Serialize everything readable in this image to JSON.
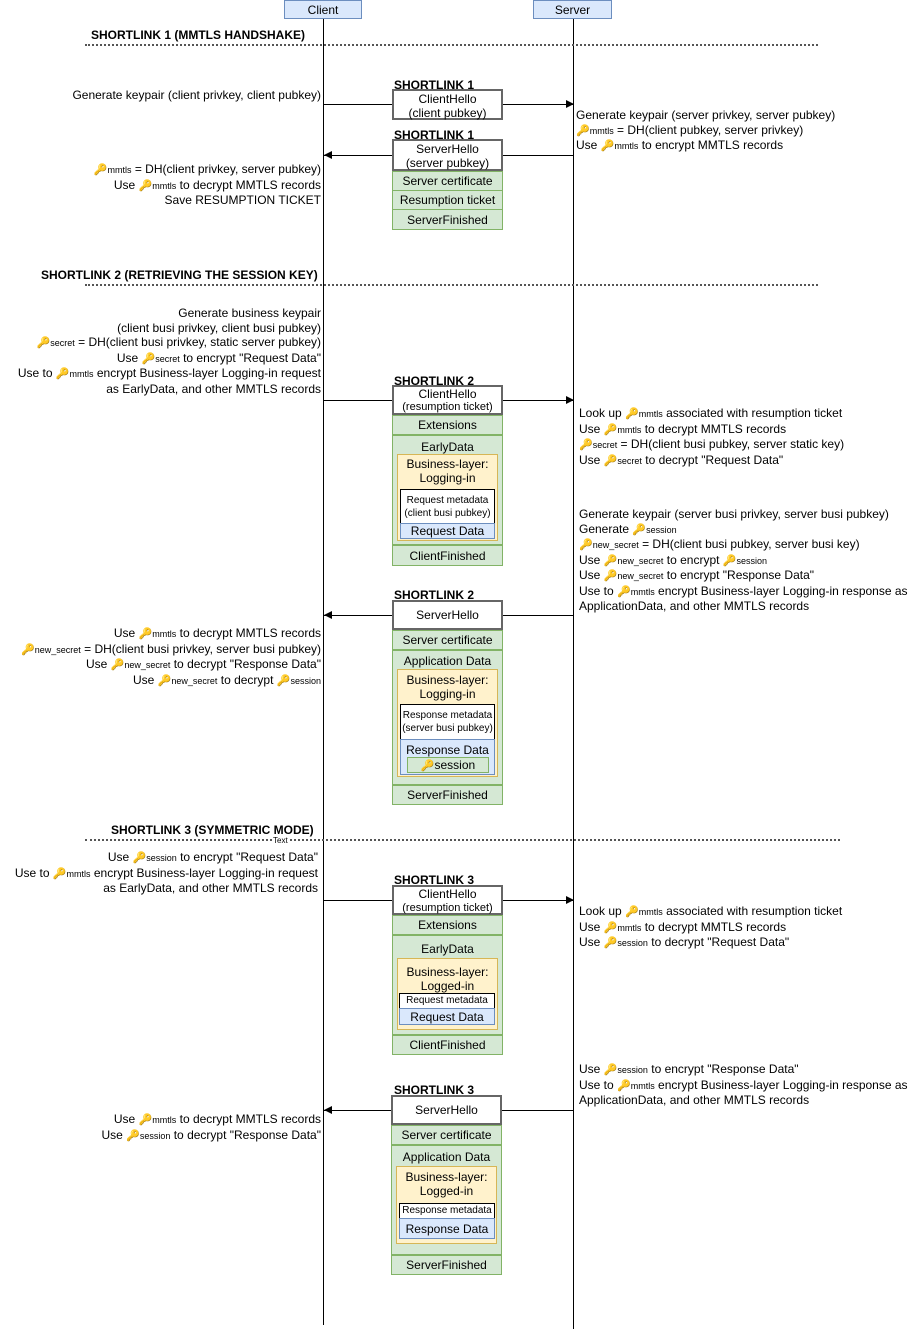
{
  "actors": {
    "client": "Client",
    "server": "Server"
  },
  "sections": [
    {
      "title": "SHORTLINK 1 (MMTLS HANDSHAKE)"
    },
    {
      "title": "SHORTLINK 2 (RETRIEVING THE SESSION KEY)"
    },
    {
      "title": "SHORTLINK 3 (SYMMETRIC MODE)",
      "annotation": "Text"
    }
  ],
  "key_glyph": "🔑",
  "keys": {
    "mmtls": "mmtls",
    "secret": "secret",
    "new_secret": "new_secret",
    "session": "session"
  },
  "sl1": {
    "label_a": "SHORTLINK 1",
    "label_b": "SHORTLINK 1",
    "client_hello": [
      "ClientHello",
      "(client pubkey)"
    ],
    "server_hello": [
      "ServerHello",
      "(server pubkey)"
    ],
    "records": [
      "Server certificate",
      "Resumption ticket",
      "ServerFinished"
    ],
    "client_note_1": "Generate keypair (client privkey, client pubkey)",
    "server_notes": {
      "l1": "Generate keypair (server privkey, server pubkey)",
      "l2_post": " = DH(client pubkey, server privkey)",
      "l3_pre": "Use ",
      "l3_post": " to encrypt MMTLS records"
    },
    "client_notes": {
      "l1_post": " = DH(client privkey, server pubkey)",
      "l2_pre": "Use ",
      "l2_post": " to decrypt MMTLS records",
      "l3": "Save RESUMPTION TICKET"
    }
  },
  "sl2": {
    "label_a": "SHORTLINK 2",
    "label_b": "SHORTLINK 2",
    "client_hello": [
      "ClientHello",
      "(resumption ticket)"
    ],
    "extensions": "Extensions",
    "early_data": "EarlyData",
    "business_layer": [
      "Business-layer:",
      "Logging-in"
    ],
    "request_metadata": [
      "Request metadata",
      "(client busi pubkey)"
    ],
    "request_data": "Request Data",
    "client_finished": "ClientFinished",
    "server_hello": "ServerHello",
    "server_certificate": "Server certificate",
    "application_data": "Application Data",
    "response_metadata": [
      "Response metadata",
      "(server busi pubkey)"
    ],
    "response_data": "Response Data",
    "session_key_label": "session",
    "server_finished": "ServerFinished",
    "client_pre": {
      "l1": "Generate business keypair",
      "l2": "(client busi privkey, client busi pubkey)",
      "l3_post": " = DH(client busi privkey, static server pubkey)",
      "l4_pre": "Use ",
      "l4_post": " to encrypt \"Request Data\"",
      "l5_pre": "Use to ",
      "l5_post": " encrypt Business-layer Logging-in request",
      "l6": "as EarlyData, and other MMTLS records"
    },
    "server_a": {
      "l1_pre": "Look up ",
      "l1_post": " associated with resumption ticket",
      "l2_pre": "Use ",
      "l2_post": " to decrypt MMTLS records",
      "l3_post": " = DH(client busi pubkey, server static key)",
      "l4_pre": "Use ",
      "l4_post": " to decrypt \"Request Data\""
    },
    "server_b": {
      "l1": "Generate keypair (server busi privkey, server busi pubkey)",
      "l2_pre": "Generate ",
      "l3_post": " = DH(client busi pubkey, server busi key)",
      "l4_pre": "Use ",
      "l4_mid": " to encrypt ",
      "l5_pre": "Use ",
      "l5_post": " to encrypt \"Response Data\"",
      "l6_pre": "Use to ",
      "l6_post": " encrypt Business-layer Logging-in response as",
      "l7": "ApplicationData, and other MMTLS records"
    },
    "client_post": {
      "l1_pre": "Use ",
      "l1_post": " to decrypt MMTLS records",
      "l2_post": " = DH(client busi privkey, server busi pubkey)",
      "l3_pre": "Use ",
      "l3_post": " to decrypt \"Response Data\"",
      "l4_pre": "Use ",
      "l4_mid": " to decrypt "
    }
  },
  "sl3": {
    "label_a": "SHORTLINK 3",
    "label_b": "SHORTLINK 3",
    "client_hello": [
      "ClientHello",
      "(resumption ticket)"
    ],
    "extensions": "Extensions",
    "early_data": "EarlyData",
    "business_layer": [
      "Business-layer:",
      "Logged-in"
    ],
    "request_metadata": "Request metadata",
    "request_data": "Request Data",
    "client_finished": "ClientFinished",
    "server_hello": "ServerHello",
    "server_certificate": "Server certificate",
    "application_data": "Application Data",
    "response_metadata": "Response metadata",
    "response_data": "Response Data",
    "server_finished": "ServerFinished",
    "client_pre": {
      "l1_pre": "Use ",
      "l1_post": " to encrypt \"Request Data\"",
      "l2_pre": "Use to ",
      "l2_post": " encrypt Business-layer Logging-in request",
      "l3": "as EarlyData, and other MMTLS records"
    },
    "server_a": {
      "l1_pre": "Look up ",
      "l1_post": " associated with resumption ticket",
      "l2_pre": "Use ",
      "l2_post": " to decrypt MMTLS records",
      "l3_pre": "Use ",
      "l3_post": " to decrypt \"Request Data\""
    },
    "server_b": {
      "l1_pre": "Use ",
      "l1_post": " to encrypt \"Response Data\"",
      "l2_pre": "Use to ",
      "l2_post": " encrypt Business-layer Logging-in response as",
      "l3": "ApplicationData, and other MMTLS records"
    },
    "client_post": {
      "l1_pre": "Use ",
      "l1_post": " to decrypt MMTLS records",
      "l2_pre": "Use ",
      "l2_post": " to decrypt \"Response Data\""
    }
  }
}
